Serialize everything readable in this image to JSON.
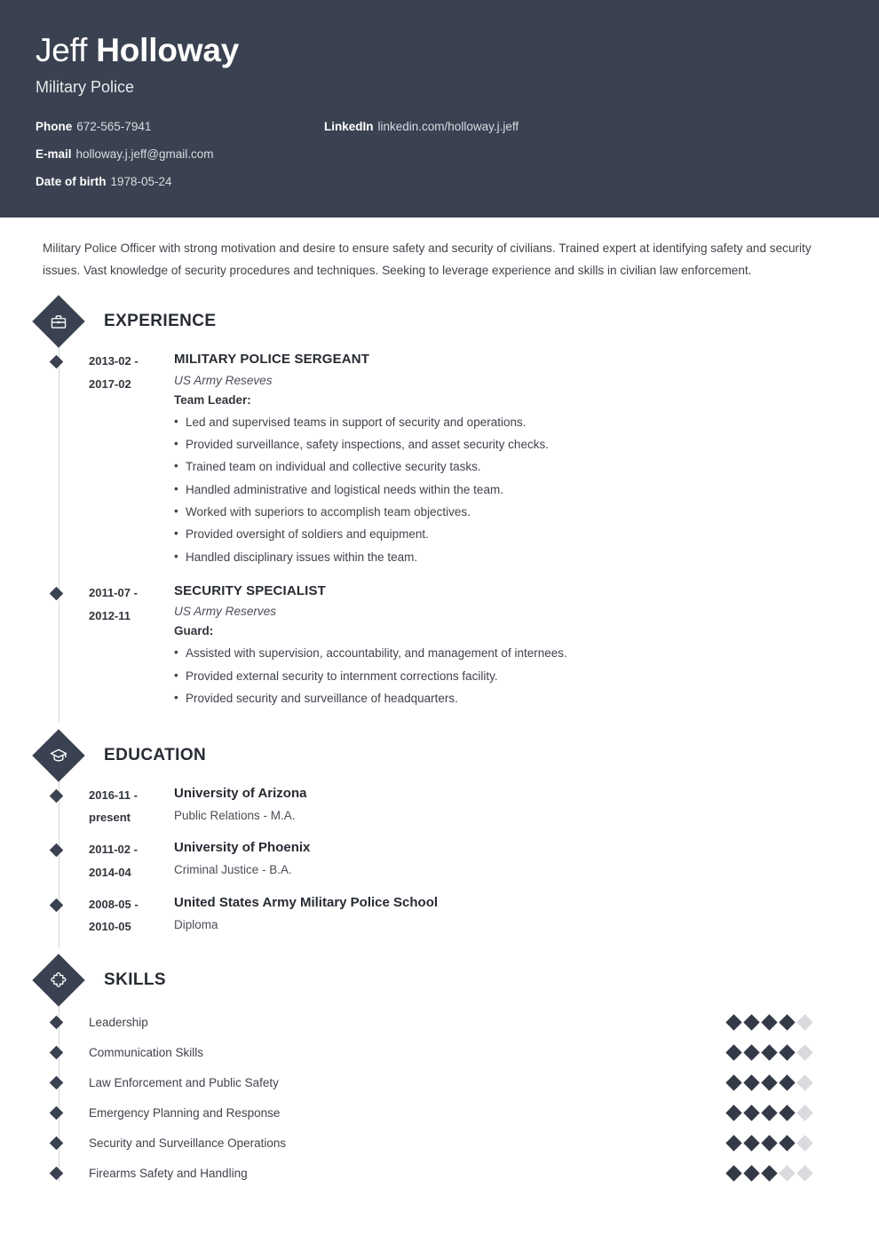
{
  "theme": {
    "header_bg": "#3a4150",
    "accent": "#3a4150",
    "text": "#3f434b",
    "rating_on": "#333946",
    "rating_off": "#d9dadd"
  },
  "header": {
    "first_name": "Jeff",
    "last_name": "Holloway",
    "job_title": "Military Police",
    "contacts_left": [
      {
        "label": "Phone",
        "value": "672-565-7941"
      },
      {
        "label": "E-mail",
        "value": "holloway.j.jeff@gmail.com"
      },
      {
        "label": "Date of birth",
        "value": "1978-05-24"
      }
    ],
    "contacts_right": [
      {
        "label": "LinkedIn",
        "value": "linkedin.com/holloway.j.jeff"
      }
    ]
  },
  "summary": "Military Police Officer with strong motivation and desire to ensure safety and security of civilians. Trained expert at identifying safety and security issues. Vast knowledge of security procedures and techniques. Seeking to leverage experience and skills in civilian law enforcement.",
  "sections": {
    "experience": {
      "title": "EXPERIENCE",
      "icon": "briefcase-icon",
      "items": [
        {
          "date_from": "2013-02 -",
          "date_to": "2017-02",
          "position": "MILITARY POLICE SERGEANT",
          "company": "US Army Reseves",
          "role": "Team Leader:",
          "bullets": [
            "Led and supervised teams in support of security and operations.",
            "Provided surveillance, safety inspections, and asset security checks.",
            "Trained team on individual and collective security tasks.",
            "Handled administrative and logistical needs within the team.",
            "Worked with superiors to accomplish team objectives.",
            "Provided oversight of soldiers and equipment.",
            "Handled disciplinary issues within the team."
          ]
        },
        {
          "date_from": "2011-07 -",
          "date_to": "2012-11",
          "position": "SECURITY SPECIALIST",
          "company": "US Army Reserves",
          "role": "Guard:",
          "bullets": [
            "Assisted with supervision, accountability, and management of internees.",
            "Provided external security to internment corrections facility.",
            "Provided security and surveillance of headquarters."
          ]
        }
      ]
    },
    "education": {
      "title": "EDUCATION",
      "icon": "graduation-cap-icon",
      "items": [
        {
          "date_from": "2016-11 -",
          "date_to": "present",
          "school": "University of Arizona",
          "degree": "Public Relations - M.A."
        },
        {
          "date_from": "2011-02 -",
          "date_to": "2014-04",
          "school": "University of Phoenix",
          "degree": "Criminal Justice - B.A."
        },
        {
          "date_from": "2008-05 -",
          "date_to": "2010-05",
          "school": "United States Army Military Police School",
          "degree": "Diploma"
        }
      ]
    },
    "skills": {
      "title": "SKILLS",
      "icon": "puzzle-piece-icon",
      "max_rating": 5,
      "items": [
        {
          "name": "Leadership",
          "rating": 4
        },
        {
          "name": "Communication Skills",
          "rating": 4
        },
        {
          "name": "Law Enforcement and Public Safety",
          "rating": 4
        },
        {
          "name": "Emergency Planning and Response",
          "rating": 4
        },
        {
          "name": "Security and Surveillance Operations",
          "rating": 4
        },
        {
          "name": "Firearms Safety and Handling",
          "rating": 3
        }
      ]
    }
  }
}
